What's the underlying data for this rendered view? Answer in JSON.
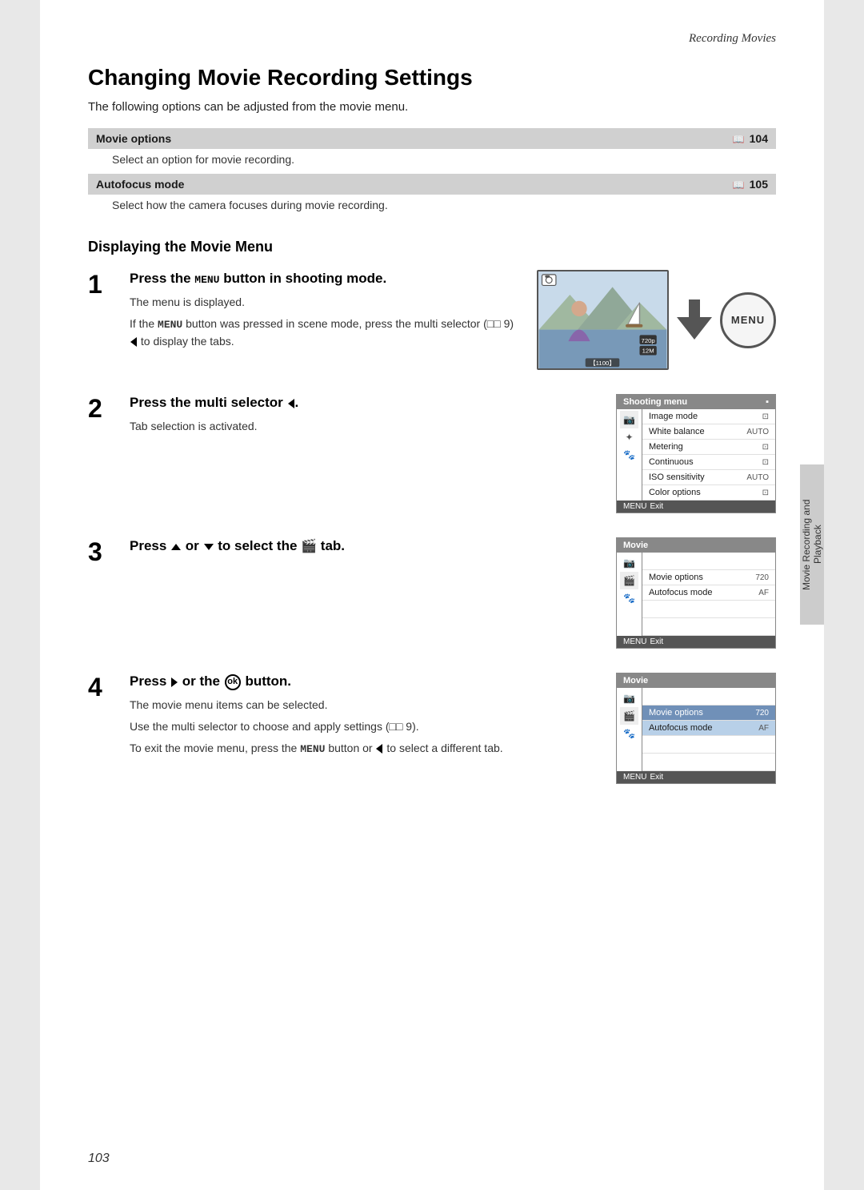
{
  "header": {
    "section": "Recording Movies"
  },
  "page": {
    "title": "Changing Movie Recording Settings",
    "intro": "The following options can be adjusted from the movie menu."
  },
  "options": [
    {
      "label": "Movie options",
      "page_ref": "104",
      "desc": "Select an option for movie recording."
    },
    {
      "label": "Autofocus mode",
      "page_ref": "105",
      "desc": "Select how the camera focuses during movie recording."
    }
  ],
  "subsection_title": "Displaying the Movie Menu",
  "steps": [
    {
      "number": "1",
      "heading_pre": "Press the ",
      "heading_key": "MENU",
      "heading_post": " button in shooting mode.",
      "descs": [
        "The menu is displayed.",
        "If the MENU button was pressed in scene mode, press the multi selector (□□ 9) ◄ to display the tabs."
      ],
      "image_type": "camera_scene",
      "menu_key_in_desc": true
    },
    {
      "number": "2",
      "heading_pre": "Press the multi selector ",
      "heading_key": "◄",
      "heading_post": ".",
      "descs": [
        "Tab selection is activated."
      ],
      "image_type": "shooting_menu"
    },
    {
      "number": "3",
      "heading_pre": "Press ",
      "heading_tri_up": true,
      "heading_or": " or ",
      "heading_tri_down": true,
      "heading_post_after_icons": " to select the ",
      "heading_movie_icon": true,
      "heading_end": " tab.",
      "descs": [],
      "image_type": "movie_menu_1"
    },
    {
      "number": "4",
      "heading_pre": "Press ",
      "heading_tri_right": true,
      "heading_or2": " or the ",
      "heading_ok": true,
      "heading_end2": " button.",
      "descs": [
        "The movie menu items can be selected.",
        "Use the multi selector to choose and apply settings (□□ 9).",
        "To exit the movie menu, press the MENU button or ◄ to select a different tab."
      ],
      "image_type": "movie_menu_2",
      "menu_key_in_desc4": true
    }
  ],
  "shooting_menu": {
    "title": "Shooting menu",
    "items": [
      {
        "icon": "camera",
        "label": "Image mode",
        "value": "⊡",
        "active": false
      },
      {
        "icon": "",
        "label": "White balance",
        "value": "AUTO",
        "active": false
      },
      {
        "icon": "star",
        "label": "Metering",
        "value": "⊡",
        "active": false
      },
      {
        "icon": "",
        "label": "Continuous",
        "value": "⊡",
        "active": false
      },
      {
        "icon": "paw",
        "label": "ISO sensitivity",
        "value": "AUTO",
        "active": false
      },
      {
        "icon": "",
        "label": "Color options",
        "value": "⊡",
        "active": false
      }
    ],
    "footer": "MENU Exit"
  },
  "movie_menu_1": {
    "title": "Movie",
    "items": [
      {
        "icon": "camera",
        "label": "",
        "value": "",
        "active": false
      },
      {
        "icon": "",
        "label": "Movie options",
        "value": "720",
        "active": false
      },
      {
        "icon": "",
        "label": "Autofocus mode",
        "value": "AF",
        "active": false
      },
      {
        "icon": "star",
        "label": "",
        "value": "",
        "active": false
      },
      {
        "icon": "paw",
        "label": "",
        "value": "",
        "active": false
      }
    ],
    "footer": "MENU Exit"
  },
  "movie_menu_2": {
    "title": "Movie",
    "items": [
      {
        "icon": "camera",
        "label": "",
        "value": "",
        "active": false
      },
      {
        "icon": "",
        "label": "Movie options",
        "value": "720",
        "active": true,
        "selected": true
      },
      {
        "icon": "",
        "label": "Autofocus mode",
        "value": "AF",
        "active": false,
        "highlighted": true
      },
      {
        "icon": "star",
        "label": "",
        "value": "",
        "active": false
      },
      {
        "icon": "paw",
        "label": "",
        "value": "",
        "active": false
      }
    ],
    "footer": "MENU Exit"
  },
  "page_number": "103",
  "sidebar_label": "Movie Recording and Playback"
}
